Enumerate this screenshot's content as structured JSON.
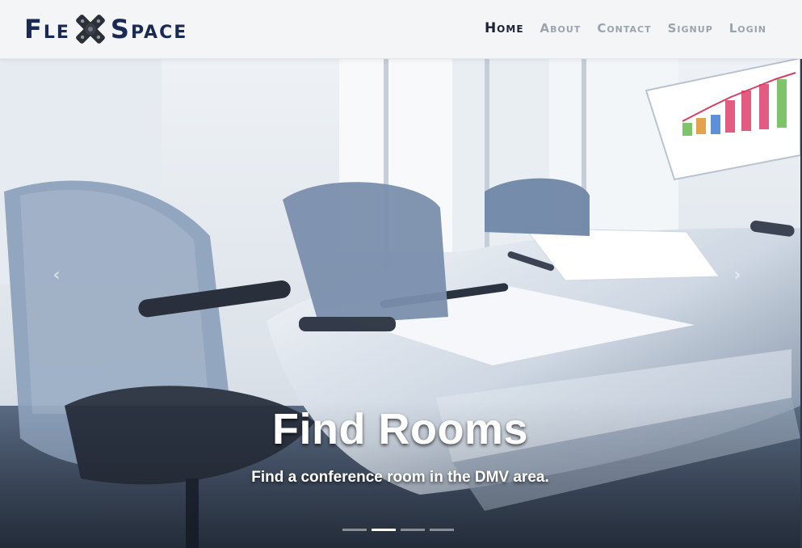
{
  "brand": {
    "name_left": "Fle",
    "name_right": "Space"
  },
  "nav": {
    "items": [
      {
        "label": "Home",
        "active": true
      },
      {
        "label": "About",
        "active": false
      },
      {
        "label": "Contact",
        "active": false
      },
      {
        "label": "Signup",
        "active": false
      },
      {
        "label": "Login",
        "active": false
      }
    ]
  },
  "hero": {
    "title": "Find Rooms",
    "subtitle": "Find a conference room in the DMV area.",
    "prev_icon": "chevron-left-icon",
    "next_icon": "chevron-right-icon",
    "slide_count": 4,
    "active_slide_index": 1
  },
  "colors": {
    "brand_navy": "#1b2a55",
    "nav_inactive": "#9aa3ae",
    "nav_active": "#1b2233",
    "header_bg": "#f3f5f7"
  }
}
